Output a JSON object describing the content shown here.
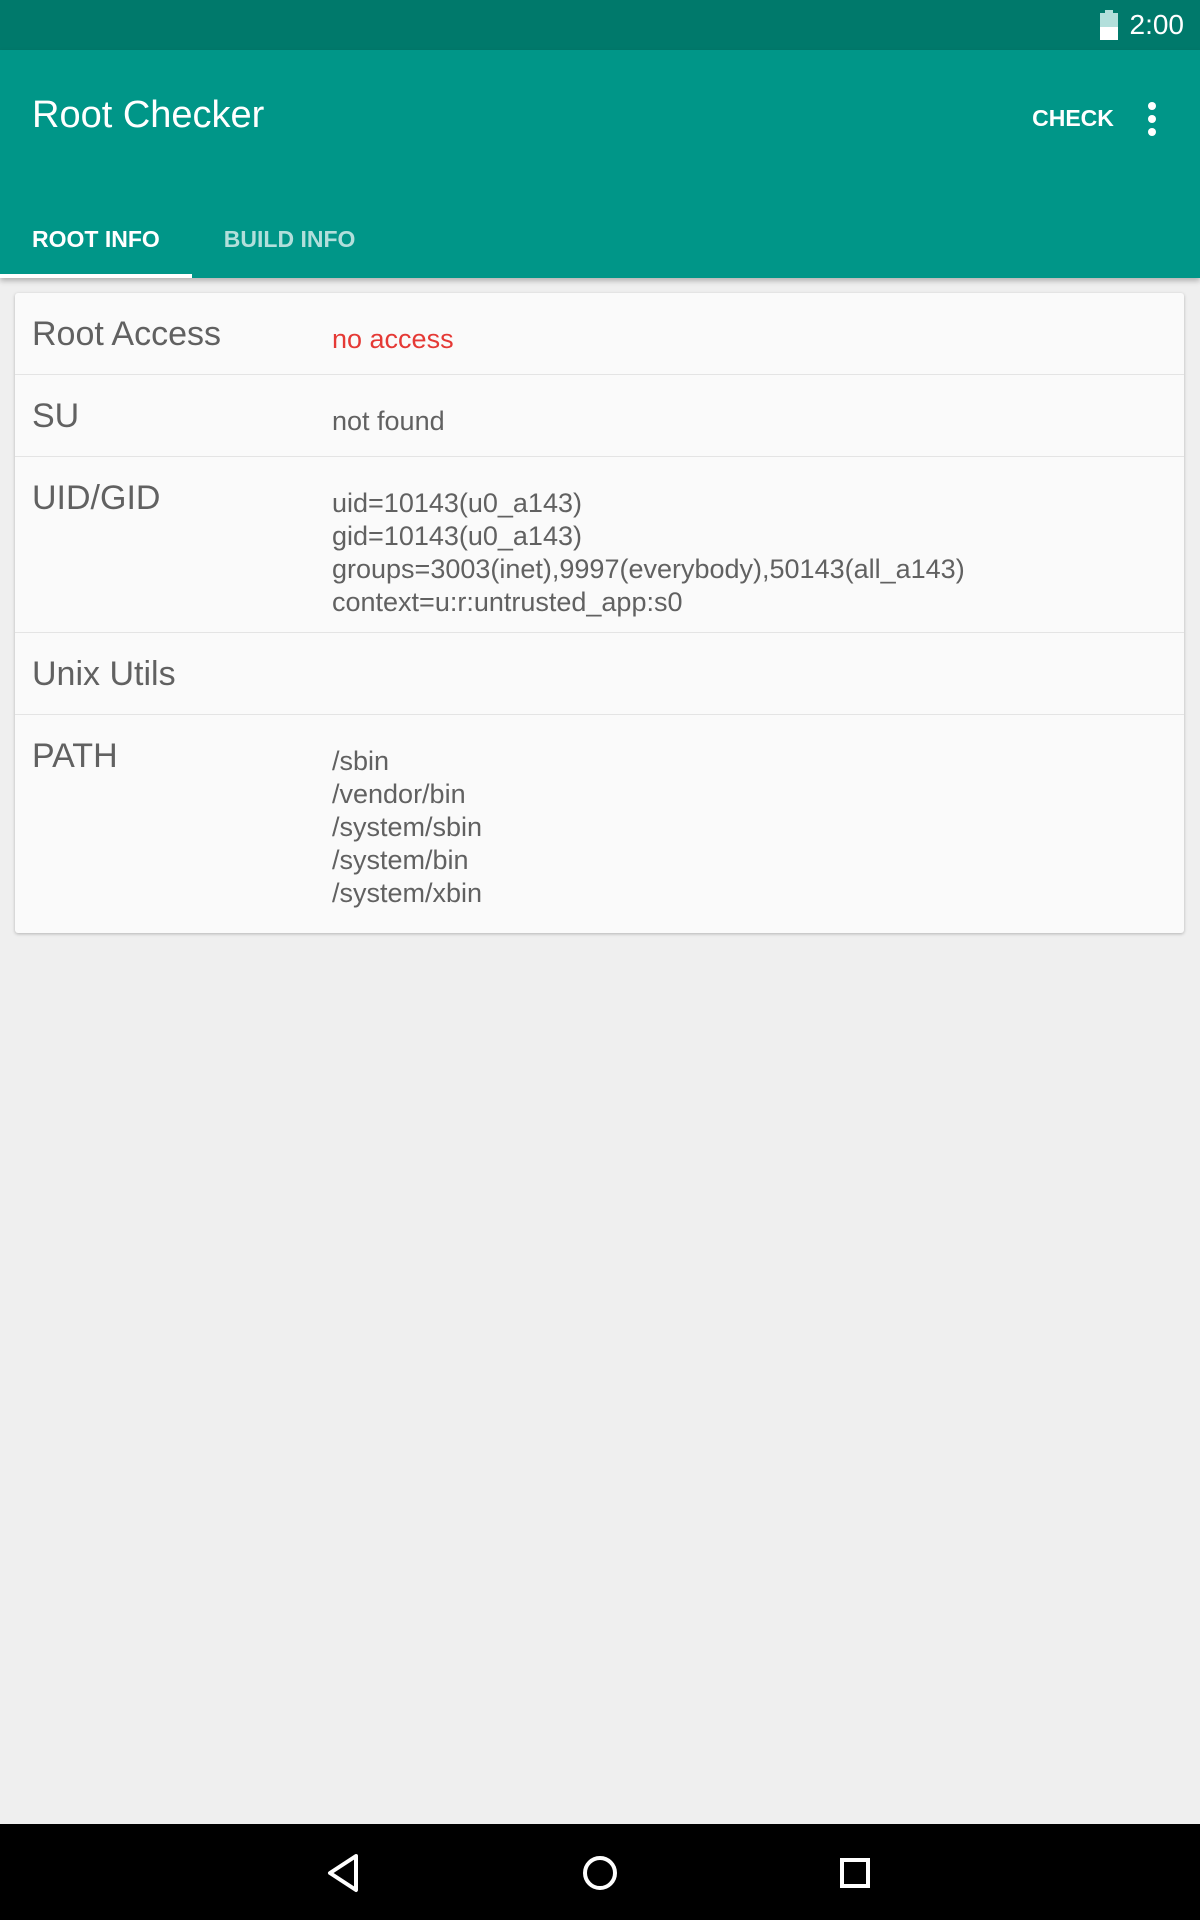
{
  "status_bar": {
    "time": "2:00",
    "battery_icon": "battery-half-icon"
  },
  "app_bar": {
    "title": "Root Checker",
    "check_label": "CHECK",
    "overflow_icon": "more-vert-icon"
  },
  "tabs": [
    {
      "label": "ROOT INFO",
      "active": true
    },
    {
      "label": "BUILD INFO",
      "active": false
    }
  ],
  "rows": [
    {
      "label": "Root Access",
      "value": [
        "no access"
      ]
    },
    {
      "label": "SU",
      "value": [
        "not found"
      ]
    },
    {
      "label": "UID/GID",
      "value": [
        "uid=10143(u0_a143)",
        "gid=10143(u0_a143)",
        "groups=3003(inet),9997(everybody),50143(all_a143)",
        "context=u:r:untrusted_app:s0"
      ]
    },
    {
      "label": "Unix Utils",
      "value": []
    },
    {
      "label": "PATH",
      "value": [
        "/sbin",
        "/vendor/bin",
        "/system/sbin",
        "/system/bin",
        "/system/xbin"
      ]
    }
  ],
  "colors": {
    "status_bar": "#00796b",
    "app_bar": "#009688",
    "error_text": "#e53935"
  },
  "nav_bar": {
    "back_icon": "back-triangle-icon",
    "home_icon": "home-circle-icon",
    "recents_icon": "recents-square-icon"
  }
}
